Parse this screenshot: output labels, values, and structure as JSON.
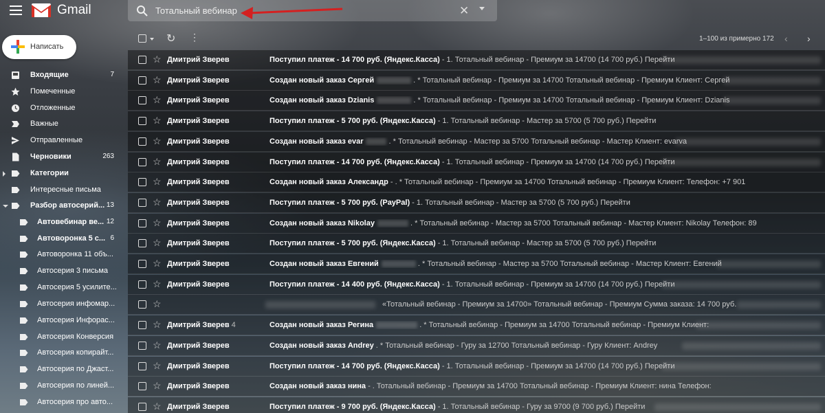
{
  "app": {
    "title": "Gmail"
  },
  "search": {
    "query": "Тотальный вебинар"
  },
  "compose": {
    "label": "Написать"
  },
  "toolbar": {
    "pager": "1–100 из примерно 172"
  },
  "sidebar": {
    "items": [
      {
        "label": "Входящие",
        "count": "7",
        "bold": true,
        "icon": "inbox-icon"
      },
      {
        "label": "Помеченные",
        "count": "",
        "bold": false,
        "icon": "star-icon"
      },
      {
        "label": "Отложенные",
        "count": "",
        "bold": false,
        "icon": "clock-icon"
      },
      {
        "label": "Важные",
        "count": "",
        "bold": false,
        "icon": "important-icon"
      },
      {
        "label": "Отправленные",
        "count": "",
        "bold": false,
        "icon": "send-icon"
      },
      {
        "label": "Черновики",
        "count": "263",
        "bold": true,
        "icon": "draft-icon"
      },
      {
        "label": "Категории",
        "count": "",
        "bold": true,
        "icon": "label-icon"
      },
      {
        "label": "Интересные письма",
        "count": "",
        "bold": false,
        "icon": "label-icon"
      },
      {
        "label": "Разбор автосерий...",
        "count": "13",
        "bold": true,
        "icon": "label-icon"
      },
      {
        "label": "Автовебинар ве...",
        "count": "12",
        "bold": true,
        "icon": "label-icon"
      },
      {
        "label": "Автоворонка 5 с...",
        "count": "6",
        "bold": true,
        "icon": "label-icon"
      },
      {
        "label": "Автоворонка 11 объ...",
        "count": "",
        "bold": false,
        "icon": "label-icon"
      },
      {
        "label": "Автосерия 3 письма",
        "count": "",
        "bold": false,
        "icon": "label-icon"
      },
      {
        "label": "Автосерия 5 усилите...",
        "count": "",
        "bold": false,
        "icon": "label-icon"
      },
      {
        "label": "Автосерия инфомар...",
        "count": "",
        "bold": false,
        "icon": "label-icon"
      },
      {
        "label": "Автосерия Инфорас...",
        "count": "",
        "bold": false,
        "icon": "label-icon"
      },
      {
        "label": "Автосерия Конверсия",
        "count": "",
        "bold": false,
        "icon": "label-icon"
      },
      {
        "label": "Автосерия копирайт...",
        "count": "",
        "bold": false,
        "icon": "label-icon"
      },
      {
        "label": "Автосерия по Джаст...",
        "count": "",
        "bold": false,
        "icon": "label-icon"
      },
      {
        "label": "Автосерия по линей...",
        "count": "",
        "bold": false,
        "icon": "label-icon"
      },
      {
        "label": "Автосерия про авто...",
        "count": "",
        "bold": false,
        "icon": "label-icon"
      }
    ]
  },
  "emails": [
    {
      "sender": "Дмитрий Зверев",
      "count": "",
      "subject": "Поступил платеж - 14 700 руб. (Яндекс.Касса)",
      "snippet": " - 1. Тотальный вебинар - Премиум за 14700 (14 700 руб.) Перейти"
    },
    {
      "sender": "Дмитрий Зверев",
      "count": "",
      "subject": "Создан новый заказ Сергей",
      "snippet": " . * Тотальный вебинар - Премиум за 14700 Тотальный вебинар - Премиум Клиент: Сергей"
    },
    {
      "sender": "Дмитрий Зверев",
      "count": "",
      "subject": "Создан новый заказ Dzianis",
      "snippet": " . * Тотальный вебинар - Премиум за 14700 Тотальный вебинар - Премиум Клиент: Dzianis"
    },
    {
      "sender": "Дмитрий Зверев",
      "count": "",
      "subject": "Поступил платеж - 5 700 руб. (Яндекс.Касса)",
      "snippet": " - 1. Тотальный вебинар - Мастер за 5700 (5 700 руб.) Перейти"
    },
    {
      "sender": "Дмитрий Зверев",
      "count": "",
      "subject": "Создан новый заказ evar",
      "snippet": " . * Тотальный вебинар - Мастер за 5700 Тотальный вебинар - Мастер Клиент: evarva"
    },
    {
      "sender": "Дмитрий Зверев",
      "count": "",
      "subject": "Поступил платеж - 14 700 руб. (Яндекс.Касса)",
      "snippet": " - 1. Тотальный вебинар - Премиум за 14700 (14 700 руб.) Перейти"
    },
    {
      "sender": "Дмитрий Зверев",
      "count": "",
      "subject": "Создан новый заказ Александр",
      "snippet": " - . * Тотальный вебинар - Премиум за 14700 Тотальный вебинар - Премиум Клиент:            Телефон: +7 901"
    },
    {
      "sender": "Дмитрий Зверев",
      "count": "",
      "subject": "Поступил платеж - 5 700 руб. (PayPal)",
      "snippet": " - 1. Тотальный вебинар - Мастер за 5700 (5 700 руб.) Перейти"
    },
    {
      "sender": "Дмитрий Зверев",
      "count": "",
      "subject": "Создан новый заказ Nikolay",
      "snippet": " . * Тотальный вебинар - Мастер за 5700 Тотальный вебинар - Мастер Клиент: Nikolay          Телефон: 89"
    },
    {
      "sender": "Дмитрий Зверев",
      "count": "",
      "subject": "Поступил платеж - 5 700 руб. (Яндекс.Касса)",
      "snippet": " - 1. Тотальный вебинар - Мастер за 5700 (5 700 руб.) Перейти"
    },
    {
      "sender": "Дмитрий Зверев",
      "count": "",
      "subject": "Создан новый заказ Евгений",
      "snippet": " . * Тотальный вебинар - Мастер за 5700 Тотальный вебинар - Мастер Клиент: Евгений"
    },
    {
      "sender": "Дмитрий Зверев",
      "count": "",
      "subject": "Поступил платеж - 14 400 руб. (Яндекс.Касса)",
      "snippet": " - 1. Тотальный вебинар - Премиум за 14700 (14 700 руб.) Перейти"
    },
    {
      "sender": "",
      "count": "",
      "subject": "",
      "snippet": " «Тотальный вебинар - Премиум за 14700» Тотальный вебинар - Премиум Сумма заказа: 14 700 руб."
    },
    {
      "sender": "Дмитрий Зверев",
      "count": "4",
      "subject": "Создан новый заказ Регина",
      "snippet": " . * Тотальный вебинар - Премиум за 14700 Тотальный вебинар - Премиум Клиент:"
    },
    {
      "sender": "Дмитрий Зверев",
      "count": "",
      "subject": "Создан новый заказ Andrey",
      "snippet": " . * Тотальный вебинар - Гуру за 12700 Тотальный вебинар - Гуру Клиент: Andrey"
    },
    {
      "sender": "Дмитрий Зверев",
      "count": "",
      "subject": "Поступил платеж - 14 700 руб. (Яндекс.Касса)",
      "snippet": " - 1. Тотальный вебинар - Премиум за 14700 (14 700 руб.) Перейти"
    },
    {
      "sender": "Дмитрий Зверев",
      "count": "",
      "subject": "Создан новый заказ нина",
      "snippet": " - . Тотальный вебинар - Премиум за 14700 Тотальный вебинар - Премиум Клиент: нина Телефон:"
    },
    {
      "sender": "Дмитрий Зверев",
      "count": "",
      "subject": "Поступил платеж - 9 700 руб. (Яндекс.Касса)",
      "snippet": " - 1. Тотальный вебинар - Гуру за 9700 (9 700 руб.) Перейти"
    }
  ]
}
